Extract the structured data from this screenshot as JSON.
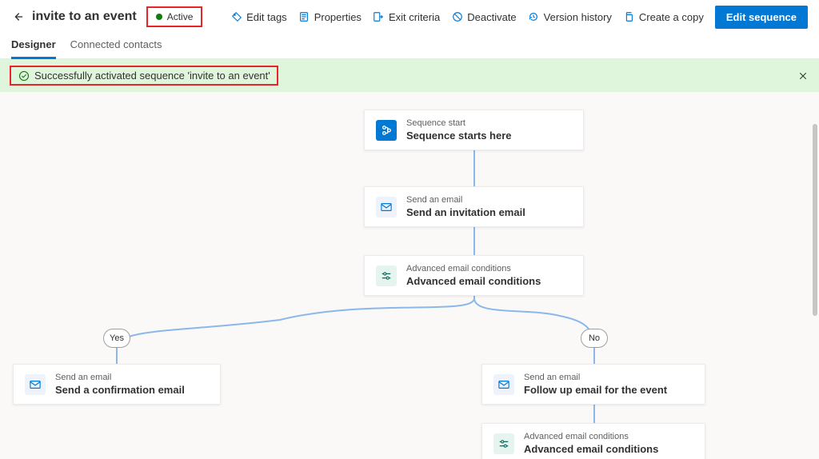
{
  "header": {
    "title": "invite to an event",
    "status_label": "Active"
  },
  "toolbar": {
    "edit_tags": "Edit tags",
    "properties": "Properties",
    "exit_criteria": "Exit criteria",
    "deactivate": "Deactivate",
    "version_history": "Version history",
    "create_copy": "Create a copy",
    "edit_sequence": "Edit sequence"
  },
  "tabs": {
    "designer": "Designer",
    "connected_contacts": "Connected contacts"
  },
  "banner": {
    "message": "Successfully activated sequence 'invite to an event'"
  },
  "nodes": {
    "start": {
      "sub": "Sequence start",
      "title": "Sequence starts here"
    },
    "email_invite": {
      "sub": "Send an email",
      "title": "Send an invitation email"
    },
    "cond1": {
      "sub": "Advanced email conditions",
      "title": "Advanced email conditions"
    },
    "email_confirm": {
      "sub": "Send an email",
      "title": "Send a confirmation email"
    },
    "email_follow": {
      "sub": "Send an email",
      "title": "Follow up email for the event"
    },
    "cond2": {
      "sub": "Advanced email conditions",
      "title": "Advanced email conditions"
    }
  },
  "branches": {
    "yes": "Yes",
    "no": "No"
  }
}
